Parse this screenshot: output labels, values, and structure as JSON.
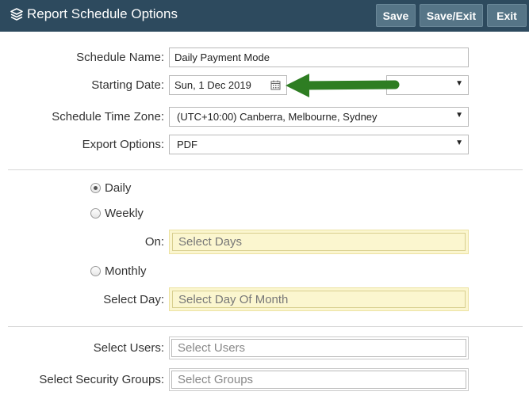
{
  "header": {
    "title": "Report Schedule Options",
    "title_icon": "layers-icon",
    "buttons": {
      "save": "Save",
      "save_exit": "Save/Exit",
      "exit": "Exit"
    }
  },
  "form": {
    "schedule_name": {
      "label": "Schedule Name:",
      "value": "Daily Payment Mode"
    },
    "starting_date": {
      "label": "Starting Date:",
      "value": "Sun, 1 Dec 2019",
      "icon": "calendar-icon"
    },
    "time_select": {
      "value": ""
    },
    "time_zone": {
      "label": "Schedule Time Zone:",
      "value": "(UTC+10:00) Canberra, Melbourne, Sydney"
    },
    "export_options": {
      "label": "Export Options:",
      "value": "PDF"
    }
  },
  "frequency": {
    "daily": {
      "label": "Daily",
      "checked": true
    },
    "weekly": {
      "label": "Weekly",
      "checked": false
    },
    "on": {
      "label": "On:",
      "placeholder": "Select Days"
    },
    "monthly": {
      "label": "Monthly",
      "checked": false
    },
    "select_day": {
      "label": "Select Day:",
      "placeholder": "Select Day Of Month"
    }
  },
  "recipients": {
    "users": {
      "label": "Select Users:",
      "placeholder": "Select Users"
    },
    "groups": {
      "label": "Select Security Groups:",
      "placeholder": "Select Groups"
    }
  },
  "annotation": {
    "icon": "green-arrow-icon",
    "color": "#2e7d22"
  },
  "colors": {
    "header_bg": "#2d4a5e",
    "button_bg": "#567587",
    "highlight_bg": "#fbf6cf"
  }
}
